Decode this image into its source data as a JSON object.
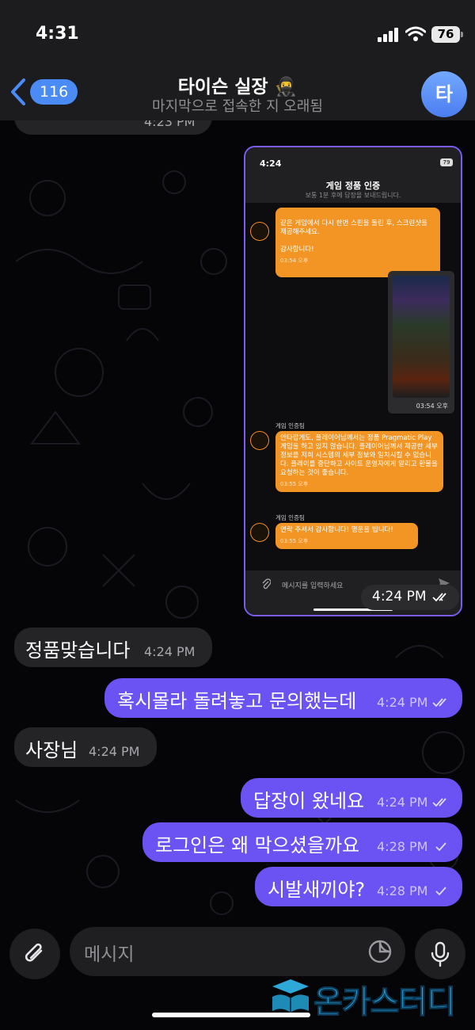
{
  "status_bar": {
    "time": "4:31",
    "battery": "76"
  },
  "header": {
    "back_count": "116",
    "title": "타이슨 실장 🥷",
    "subtitle": "마지막으로 접속한 지 오래됨",
    "avatar_letter": "타"
  },
  "messages": [
    {
      "direction": "incoming",
      "text": "정품맞습니다",
      "time": "4:24 PM"
    },
    {
      "direction": "outgoing",
      "text": "혹시몰라 돌려놓고 문의했는데",
      "time": "4:24 PM",
      "read": true
    },
    {
      "direction": "incoming",
      "text": "사장님",
      "time": "4:24 PM"
    },
    {
      "direction": "outgoing",
      "text": "답장이 왔네요",
      "time": "4:24 PM",
      "read": true
    },
    {
      "direction": "outgoing",
      "text": "로그인은 왜 막으셨을까요",
      "time": "4:28 PM",
      "read": false
    },
    {
      "direction": "outgoing",
      "text": "시발새끼야?",
      "time": "4:28 PM",
      "read": false
    }
  ],
  "top_partial_time": "4:23 PM",
  "screenshot_message": {
    "time": "4:24 PM",
    "inner": {
      "status_time": "4:24",
      "battery": "79",
      "title": "게임 정품 인증",
      "subtitle": "보통 1분 후에 답장을 보내드립니다.",
      "bubble1": "같은 게임에서 다시 한번 스핀을 돌린 후, 스크린샷을 제공해주세요.\n\n감사합니다!",
      "bubble1_time": "03:54 오후",
      "image_time": "03:54 오후",
      "sender_name": "게임 인증팀",
      "bubble2": "안타깝게도, 플레이어님께서는 정품 Pragmatic Play 게임을 하고 있지 않습니다. 플레이어님께서 제공한 세부 정보를 저희 시스템의 세부 정보와 일치시킬 수 없습니다. 플레이를 중단하고 사이트 운영자에게 알리고 환불을 요청하는 것이 좋습니다.",
      "bubble2_time": "03:55 오후",
      "sender_name2": "게임 인증팀",
      "bubble3": "연락 주셔서 감사합니다! 행운을 빕니다!",
      "bubble3_time": "03:55 오후",
      "input_placeholder": "메시지를 입력하세요"
    }
  },
  "input": {
    "placeholder": "메시지"
  },
  "watermark": "온카스터디",
  "colors": {
    "outgoing": "#6b52f2",
    "incoming": "#242427",
    "accent": "#4a8bf5",
    "inner_bubble": "#f39524"
  }
}
